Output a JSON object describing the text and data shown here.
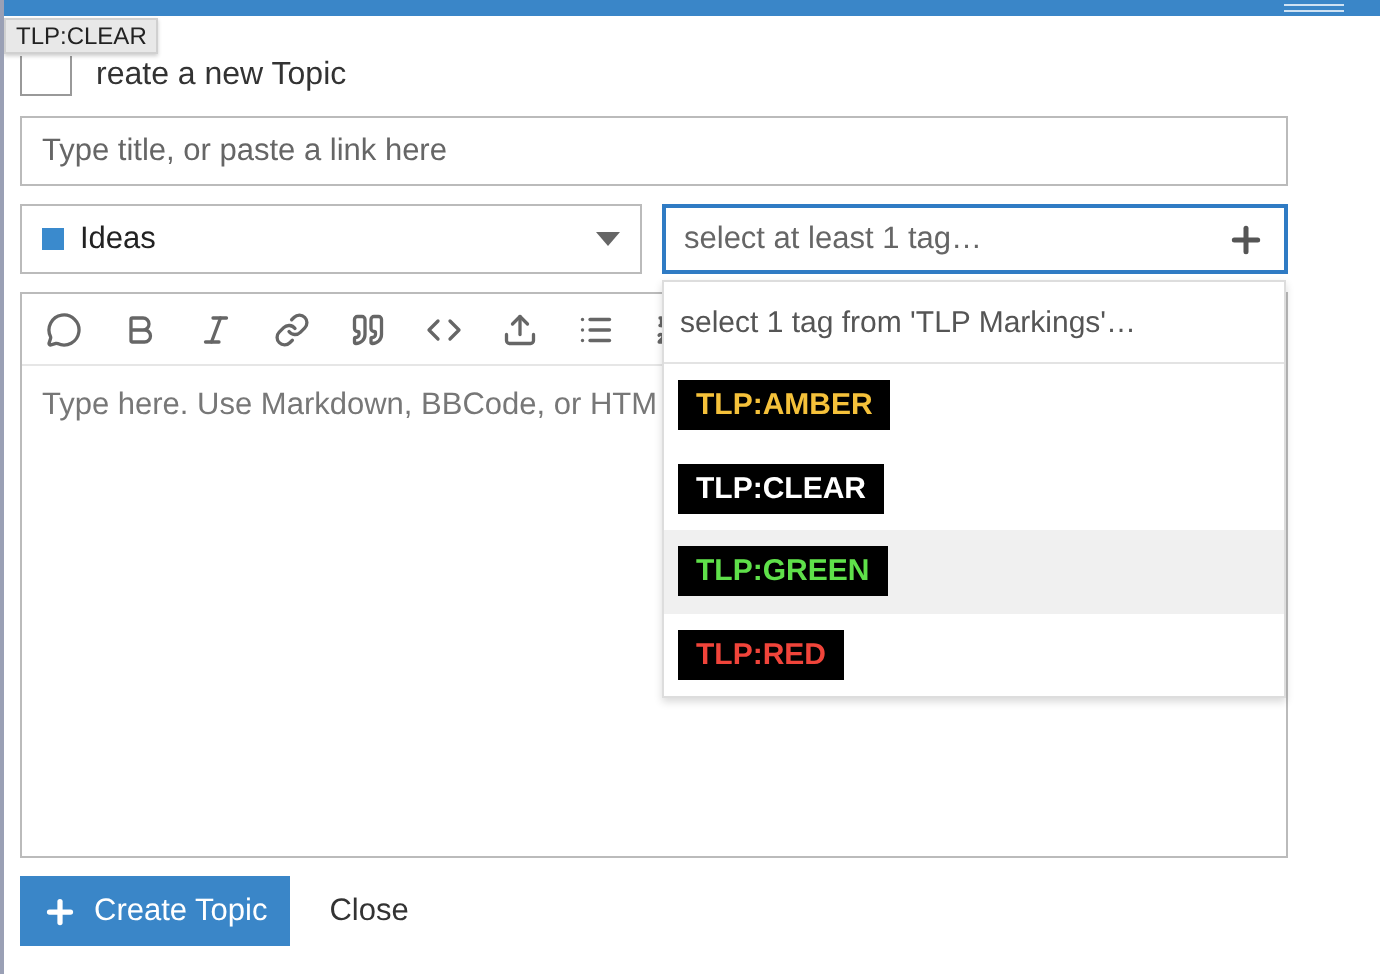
{
  "tooltip": {
    "text": "TLP:CLEAR"
  },
  "title": "reate a new Topic",
  "title_field": {
    "placeholder": "Type title, or paste a link here"
  },
  "category": {
    "label": "Ideas",
    "color": "#3a8acd"
  },
  "tag_field": {
    "placeholder": "select at least 1 tag…",
    "focused": true
  },
  "editor": {
    "placeholder": "Type here. Use Markdown, BBCode, or HTM"
  },
  "tag_dropdown": {
    "header": "select 1 tag from 'TLP Markings'…",
    "tags": [
      {
        "label": "TLP:AMBER",
        "color": "#f5c13a",
        "selected": false
      },
      {
        "label": "TLP:CLEAR",
        "color": "#ffffff",
        "selected": false
      },
      {
        "label": "TLP:GREEN",
        "color": "#5fe04a",
        "selected": true
      },
      {
        "label": "TLP:RED",
        "color": "#f0443a",
        "selected": false
      }
    ]
  },
  "buttons": [
    {
      "label": "Create Topic",
      "kind": "primary"
    },
    {
      "label": "Close",
      "kind": "link"
    }
  ]
}
